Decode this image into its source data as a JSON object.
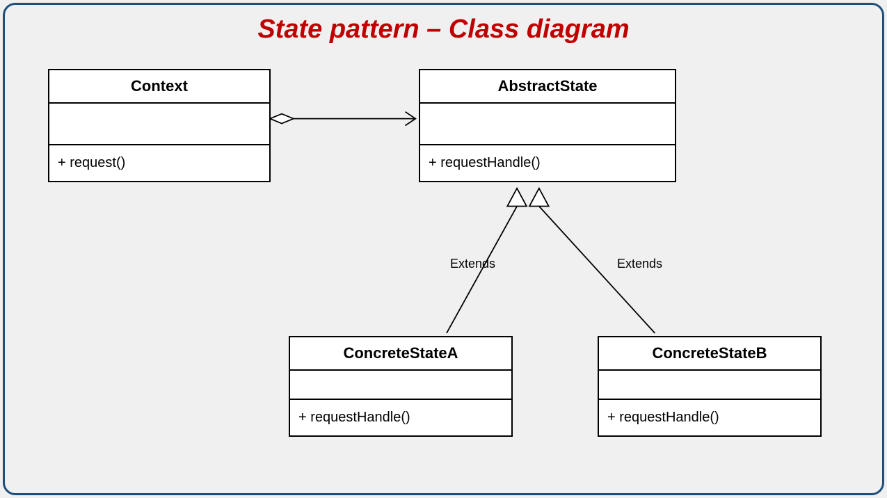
{
  "title": "State pattern – Class diagram",
  "classes": {
    "context": {
      "name": "Context",
      "op": "+ request()"
    },
    "abstract": {
      "name": "AbstractState",
      "op": "+ requestHandle()"
    },
    "concreteA": {
      "name": "ConcreteStateA",
      "op": "+ requestHandle()"
    },
    "concreteB": {
      "name": "ConcreteStateB",
      "op": "+ requestHandle()"
    }
  },
  "labels": {
    "extendsA": "Extends",
    "extendsB": "Extends"
  }
}
